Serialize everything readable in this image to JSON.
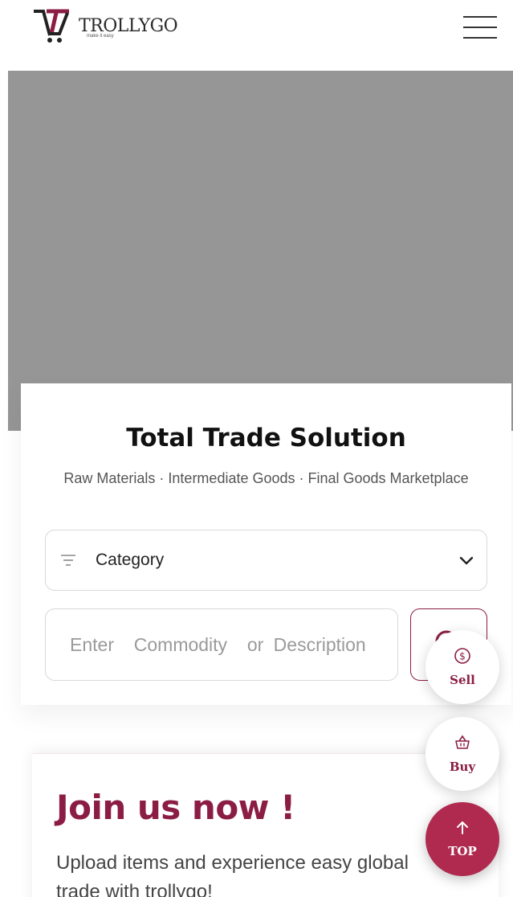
{
  "header": {
    "brand_name": "TROLLYGO",
    "brand_tagline": "make it easy",
    "menu_icon": "hamburger-menu-icon"
  },
  "hero": {
    "color": "#969696"
  },
  "search_card": {
    "title": "Total Trade Solution",
    "subtitle": "Raw Materials · Intermediate Goods · Final Goods Marketplace",
    "category_label": "Category",
    "category_icons": [
      "filter-icon",
      "chevron-down-icon"
    ],
    "search_placeholder": "Enter  Commodity  or Description",
    "search_icon": "search-icon"
  },
  "join": {
    "title": "Join us now !",
    "text": "Upload items and experience easy global trade with trollygo!"
  },
  "floating_buttons": {
    "sell_label": "Sell",
    "buy_label": "Buy",
    "top_label": "TOP",
    "icons": [
      "dollar-coin-icon",
      "basket-icon",
      "arrow-up-icon"
    ]
  },
  "colors": {
    "accent": "#8b1d44",
    "accent_fill": "#b02a4f",
    "hero_gray": "#969696"
  }
}
